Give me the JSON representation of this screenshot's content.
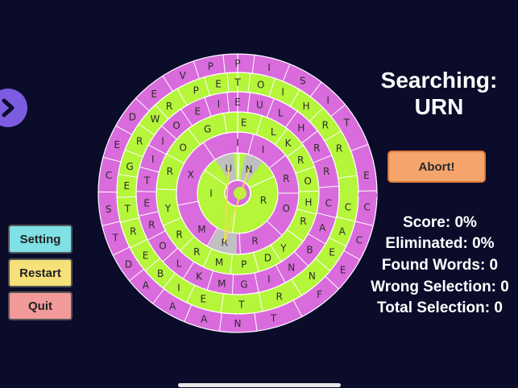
{
  "colors": {
    "background": "#0a0c2a",
    "ring_pink": "#d96bdc",
    "ring_green": "#b5f53a",
    "selected_gray": "#c0c0c0",
    "selection_line": "#f0e050",
    "abort_bg": "#f5a46c",
    "setting_bg": "#7fe0e6",
    "restart_bg": "#f5e07a",
    "quit_bg": "#f29a9a",
    "arrow_bg": "#7c5ce0"
  },
  "header": {
    "searching_label": "Searching:",
    "target_word": "URN"
  },
  "abort_label": "Abort!",
  "stats": {
    "score": "Score: 0%",
    "eliminated": "Eliminated: 0%",
    "found_words": "Found Words: 0",
    "wrong_selection": "Wrong Selection: 0",
    "total_selection": "Total Selection: 0"
  },
  "menu": {
    "setting": "Setting",
    "restart": "Restart",
    "quit": "Quit"
  },
  "icons": {
    "toggle": "chevron-right-icon"
  },
  "board": {
    "rings": [
      {
        "color": "ring_green",
        "cells": [
          {
            "ch": "I",
            "deg": 270
          },
          {
            "ch": "R",
            "deg": 105
          },
          {
            "ch": "N",
            "deg": 25,
            "sel": true
          },
          {
            "ch": "U",
            "deg": 340,
            "sel": true
          }
        ]
      },
      {
        "color": "ring_pink",
        "cells": [
          {
            "ch": "I",
            "deg": 0
          },
          {
            "ch": "I",
            "deg": 30
          },
          {
            "ch": "R",
            "deg": 73
          },
          {
            "ch": "O",
            "deg": 107
          },
          {
            "ch": "R",
            "deg": 160
          },
          {
            "ch": "R",
            "deg": 195,
            "sel": true
          },
          {
            "ch": "M",
            "deg": 225
          },
          {
            "ch": "X",
            "deg": 292
          }
        ]
      },
      {
        "color": "ring_green",
        "cells": [
          {
            "ch": "E",
            "deg": 5
          },
          {
            "ch": "L",
            "deg": 30
          },
          {
            "ch": "K",
            "deg": 45
          },
          {
            "ch": "R",
            "deg": 62
          },
          {
            "ch": "O",
            "deg": 80
          },
          {
            "ch": "H",
            "deg": 97
          },
          {
            "ch": "R",
            "deg": 113
          },
          {
            "ch": "Y",
            "deg": 140
          },
          {
            "ch": "D",
            "deg": 155
          },
          {
            "ch": "P",
            "deg": 175
          },
          {
            "ch": "M",
            "deg": 195
          },
          {
            "ch": "R",
            "deg": 215
          },
          {
            "ch": "R",
            "deg": 235
          },
          {
            "ch": "Y",
            "deg": 258
          },
          {
            "ch": "R",
            "deg": 288
          },
          {
            "ch": "O",
            "deg": 310
          },
          {
            "ch": "G",
            "deg": 335
          }
        ]
      },
      {
        "color": "ring_pink",
        "cells": [
          {
            "ch": "E",
            "deg": 0
          },
          {
            "ch": "U",
            "deg": 14
          },
          {
            "ch": "L",
            "deg": 28
          },
          {
            "ch": "H",
            "deg": 44
          },
          {
            "ch": "R",
            "deg": 60
          },
          {
            "ch": "R",
            "deg": 76
          },
          {
            "ch": "C",
            "deg": 96
          },
          {
            "ch": "A",
            "deg": 112
          },
          {
            "ch": "B",
            "deg": 128
          },
          {
            "ch": "N",
            "deg": 144
          },
          {
            "ch": "I",
            "deg": 160
          },
          {
            "ch": "G",
            "deg": 176
          },
          {
            "ch": "M",
            "deg": 190
          },
          {
            "ch": "K",
            "deg": 205
          },
          {
            "ch": "L",
            "deg": 220
          },
          {
            "ch": "O",
            "deg": 235
          },
          {
            "ch": "R",
            "deg": 250
          },
          {
            "ch": "E",
            "deg": 264
          },
          {
            "ch": "T",
            "deg": 278
          },
          {
            "ch": "I",
            "deg": 292
          },
          {
            "ch": "I",
            "deg": 305
          },
          {
            "ch": "O",
            "deg": 318
          },
          {
            "ch": "E",
            "deg": 334
          },
          {
            "ch": "I",
            "deg": 348
          }
        ]
      },
      {
        "color": "ring_green",
        "cells": [
          {
            "ch": "T",
            "deg": 0
          },
          {
            "ch": "O",
            "deg": 12
          },
          {
            "ch": "I",
            "deg": 24
          },
          {
            "ch": "H",
            "deg": 38
          },
          {
            "ch": "R",
            "deg": 52
          },
          {
            "ch": "R",
            "deg": 66
          },
          {
            "ch": "C",
            "deg": 97
          },
          {
            "ch": "A",
            "deg": 110
          },
          {
            "ch": "E",
            "deg": 122
          },
          {
            "ch": "N",
            "deg": 138
          },
          {
            "ch": "R",
            "deg": 158
          },
          {
            "ch": "T",
            "deg": 178
          },
          {
            "ch": "E",
            "deg": 198
          },
          {
            "ch": "I",
            "deg": 212
          },
          {
            "ch": "B",
            "deg": 224
          },
          {
            "ch": "E",
            "deg": 236
          },
          {
            "ch": "R",
            "deg": 250
          },
          {
            "ch": "T",
            "deg": 262
          },
          {
            "ch": "E",
            "deg": 274
          },
          {
            "ch": "G",
            "deg": 284
          },
          {
            "ch": "R",
            "deg": 298
          },
          {
            "ch": "W",
            "deg": 312
          },
          {
            "ch": "R",
            "deg": 322
          },
          {
            "ch": "P",
            "deg": 338
          },
          {
            "ch": "E",
            "deg": 350
          }
        ]
      },
      {
        "color": "ring_pink",
        "cells": [
          {
            "ch": "P",
            "deg": 0
          },
          {
            "ch": "I",
            "deg": 14
          },
          {
            "ch": "S",
            "deg": 30
          },
          {
            "ch": "I",
            "deg": 44
          },
          {
            "ch": "T",
            "deg": 57
          },
          {
            "ch": "E",
            "deg": 82
          },
          {
            "ch": "C",
            "deg": 96
          },
          {
            "ch": "C",
            "deg": 111
          },
          {
            "ch": "E",
            "deg": 126
          },
          {
            "ch": "F",
            "deg": 141
          },
          {
            "ch": "T",
            "deg": 164
          },
          {
            "ch": "N",
            "deg": 180
          },
          {
            "ch": "A",
            "deg": 195
          },
          {
            "ch": "A",
            "deg": 210
          },
          {
            "ch": "A",
            "deg": 225
          },
          {
            "ch": "D",
            "deg": 237
          },
          {
            "ch": "T",
            "deg": 250
          },
          {
            "ch": "S",
            "deg": 263
          },
          {
            "ch": "C",
            "deg": 278
          },
          {
            "ch": "E",
            "deg": 292
          },
          {
            "ch": "D",
            "deg": 306
          },
          {
            "ch": "E",
            "deg": 320
          },
          {
            "ch": "V",
            "deg": 335
          },
          {
            "ch": "P",
            "deg": 348
          }
        ]
      }
    ]
  }
}
